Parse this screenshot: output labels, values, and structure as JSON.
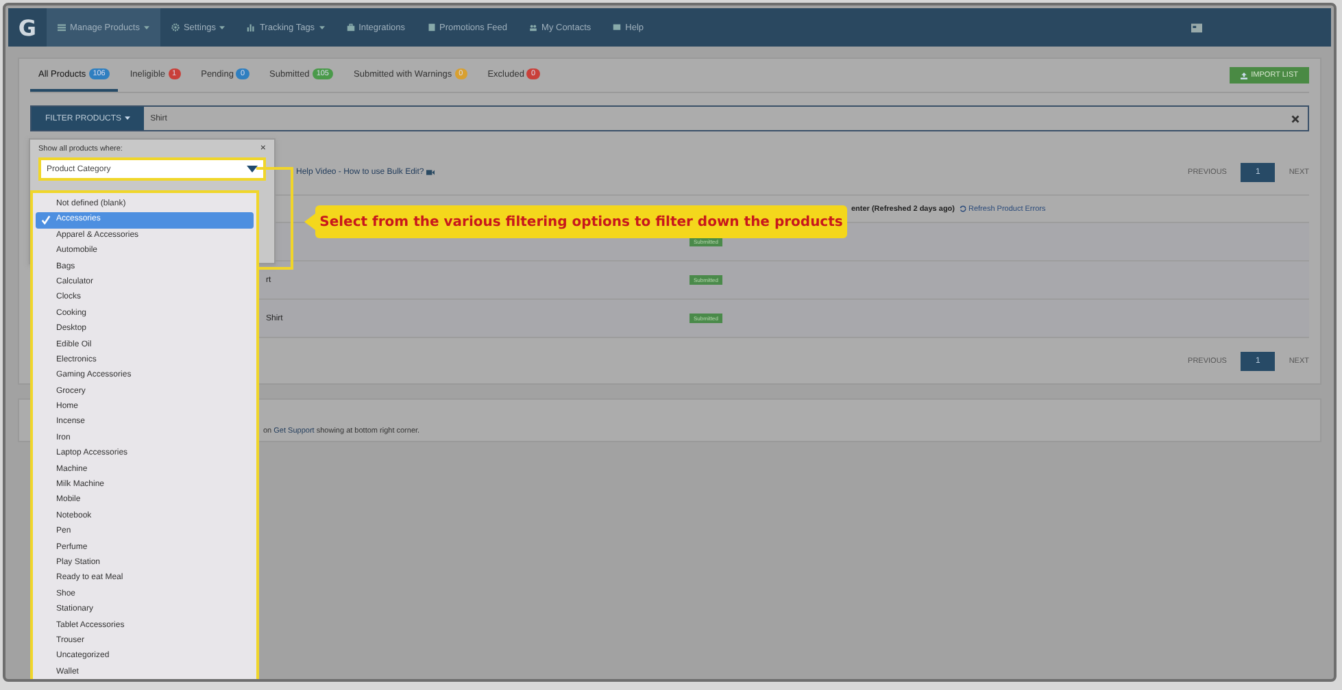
{
  "navbar": {
    "logo": "G",
    "items": [
      {
        "label": "Manage Products",
        "selected": true,
        "dropdown": true
      },
      {
        "label": "Settings",
        "selected": false,
        "dropdown": true
      },
      {
        "label": "Tracking Tags",
        "selected": false,
        "dropdown": true
      },
      {
        "label": "Integrations",
        "selected": false,
        "dropdown": false
      },
      {
        "label": "Promotions Feed",
        "selected": false,
        "dropdown": false
      },
      {
        "label": "My Contacts",
        "selected": false,
        "dropdown": false
      },
      {
        "label": "Help",
        "selected": false,
        "dropdown": false
      }
    ]
  },
  "tabs": [
    {
      "label": "All Products",
      "count": "106",
      "color": "#2f7fc0",
      "selected": true
    },
    {
      "label": "Ineligible",
      "count": "1",
      "color": "#c9403a",
      "selected": false
    },
    {
      "label": "Pending",
      "count": "0",
      "color": "#2f7fc0",
      "selected": false
    },
    {
      "label": "Submitted",
      "count": "105",
      "color": "#4a9a4a",
      "selected": false
    },
    {
      "label": "Submitted with Warnings",
      "count": "0",
      "color": "#d8a030",
      "selected": false
    },
    {
      "label": "Excluded",
      "count": "0",
      "color": "#c9403a",
      "selected": false
    }
  ],
  "import_button": "IMPORT LIST",
  "filter": {
    "button": "FILTER PRODUCTS",
    "value": "Shirt"
  },
  "help_link": "Help Video - How to use Bulk Edit?",
  "pagination_top": {
    "previous": "PREVIOUS",
    "page": "1",
    "next": "NEXT"
  },
  "status_note": {
    "text": "enter (Refreshed 2 days ago)",
    "link": "Refresh Product Errors"
  },
  "rows": [
    {
      "status": "Submitted"
    },
    {
      "name": "rt",
      "status": "Submitted"
    },
    {
      "name": "Shirt",
      "status": "Submitted"
    }
  ],
  "pagination_bottom": {
    "previous": "PREVIOUS",
    "page": "1",
    "next": "NEXT"
  },
  "support_note": {
    "before": "on",
    "link": "Get Support",
    "after": "showing at bottom right corner."
  },
  "popover": {
    "label": "Show all products where:",
    "close": "×",
    "select": "Product Category"
  },
  "dropdown": {
    "options": [
      {
        "label": "Not defined (blank)",
        "selected": false
      },
      {
        "label": "Accessories",
        "selected": true
      },
      {
        "label": "Apparel & Accessories",
        "selected": false
      },
      {
        "label": "Automobile",
        "selected": false
      },
      {
        "label": "Bags",
        "selected": false
      },
      {
        "label": "Calculator",
        "selected": false
      },
      {
        "label": "Clocks",
        "selected": false
      },
      {
        "label": "Cooking",
        "selected": false
      },
      {
        "label": "Desktop",
        "selected": false
      },
      {
        "label": "Edible Oil",
        "selected": false
      },
      {
        "label": "Electronics",
        "selected": false
      },
      {
        "label": "Gaming Accessories",
        "selected": false
      },
      {
        "label": "Grocery",
        "selected": false
      },
      {
        "label": "Home",
        "selected": false
      },
      {
        "label": "Incense",
        "selected": false
      },
      {
        "label": "Iron",
        "selected": false
      },
      {
        "label": "Laptop Accessories",
        "selected": false
      },
      {
        "label": "Machine",
        "selected": false
      },
      {
        "label": "Milk Machine",
        "selected": false
      },
      {
        "label": "Mobile",
        "selected": false
      },
      {
        "label": "Notebook",
        "selected": false
      },
      {
        "label": "Pen",
        "selected": false
      },
      {
        "label": "Perfume",
        "selected": false
      },
      {
        "label": "Play Station",
        "selected": false
      },
      {
        "label": "Ready to eat Meal",
        "selected": false
      },
      {
        "label": "Shoe",
        "selected": false
      },
      {
        "label": "Stationary",
        "selected": false
      },
      {
        "label": "Tablet Accessories",
        "selected": false
      },
      {
        "label": "Trouser",
        "selected": false
      },
      {
        "label": "Uncategorized",
        "selected": false
      },
      {
        "label": "Wallet",
        "selected": false
      }
    ]
  },
  "callout": "Select from the various filtering options to filter down the products"
}
